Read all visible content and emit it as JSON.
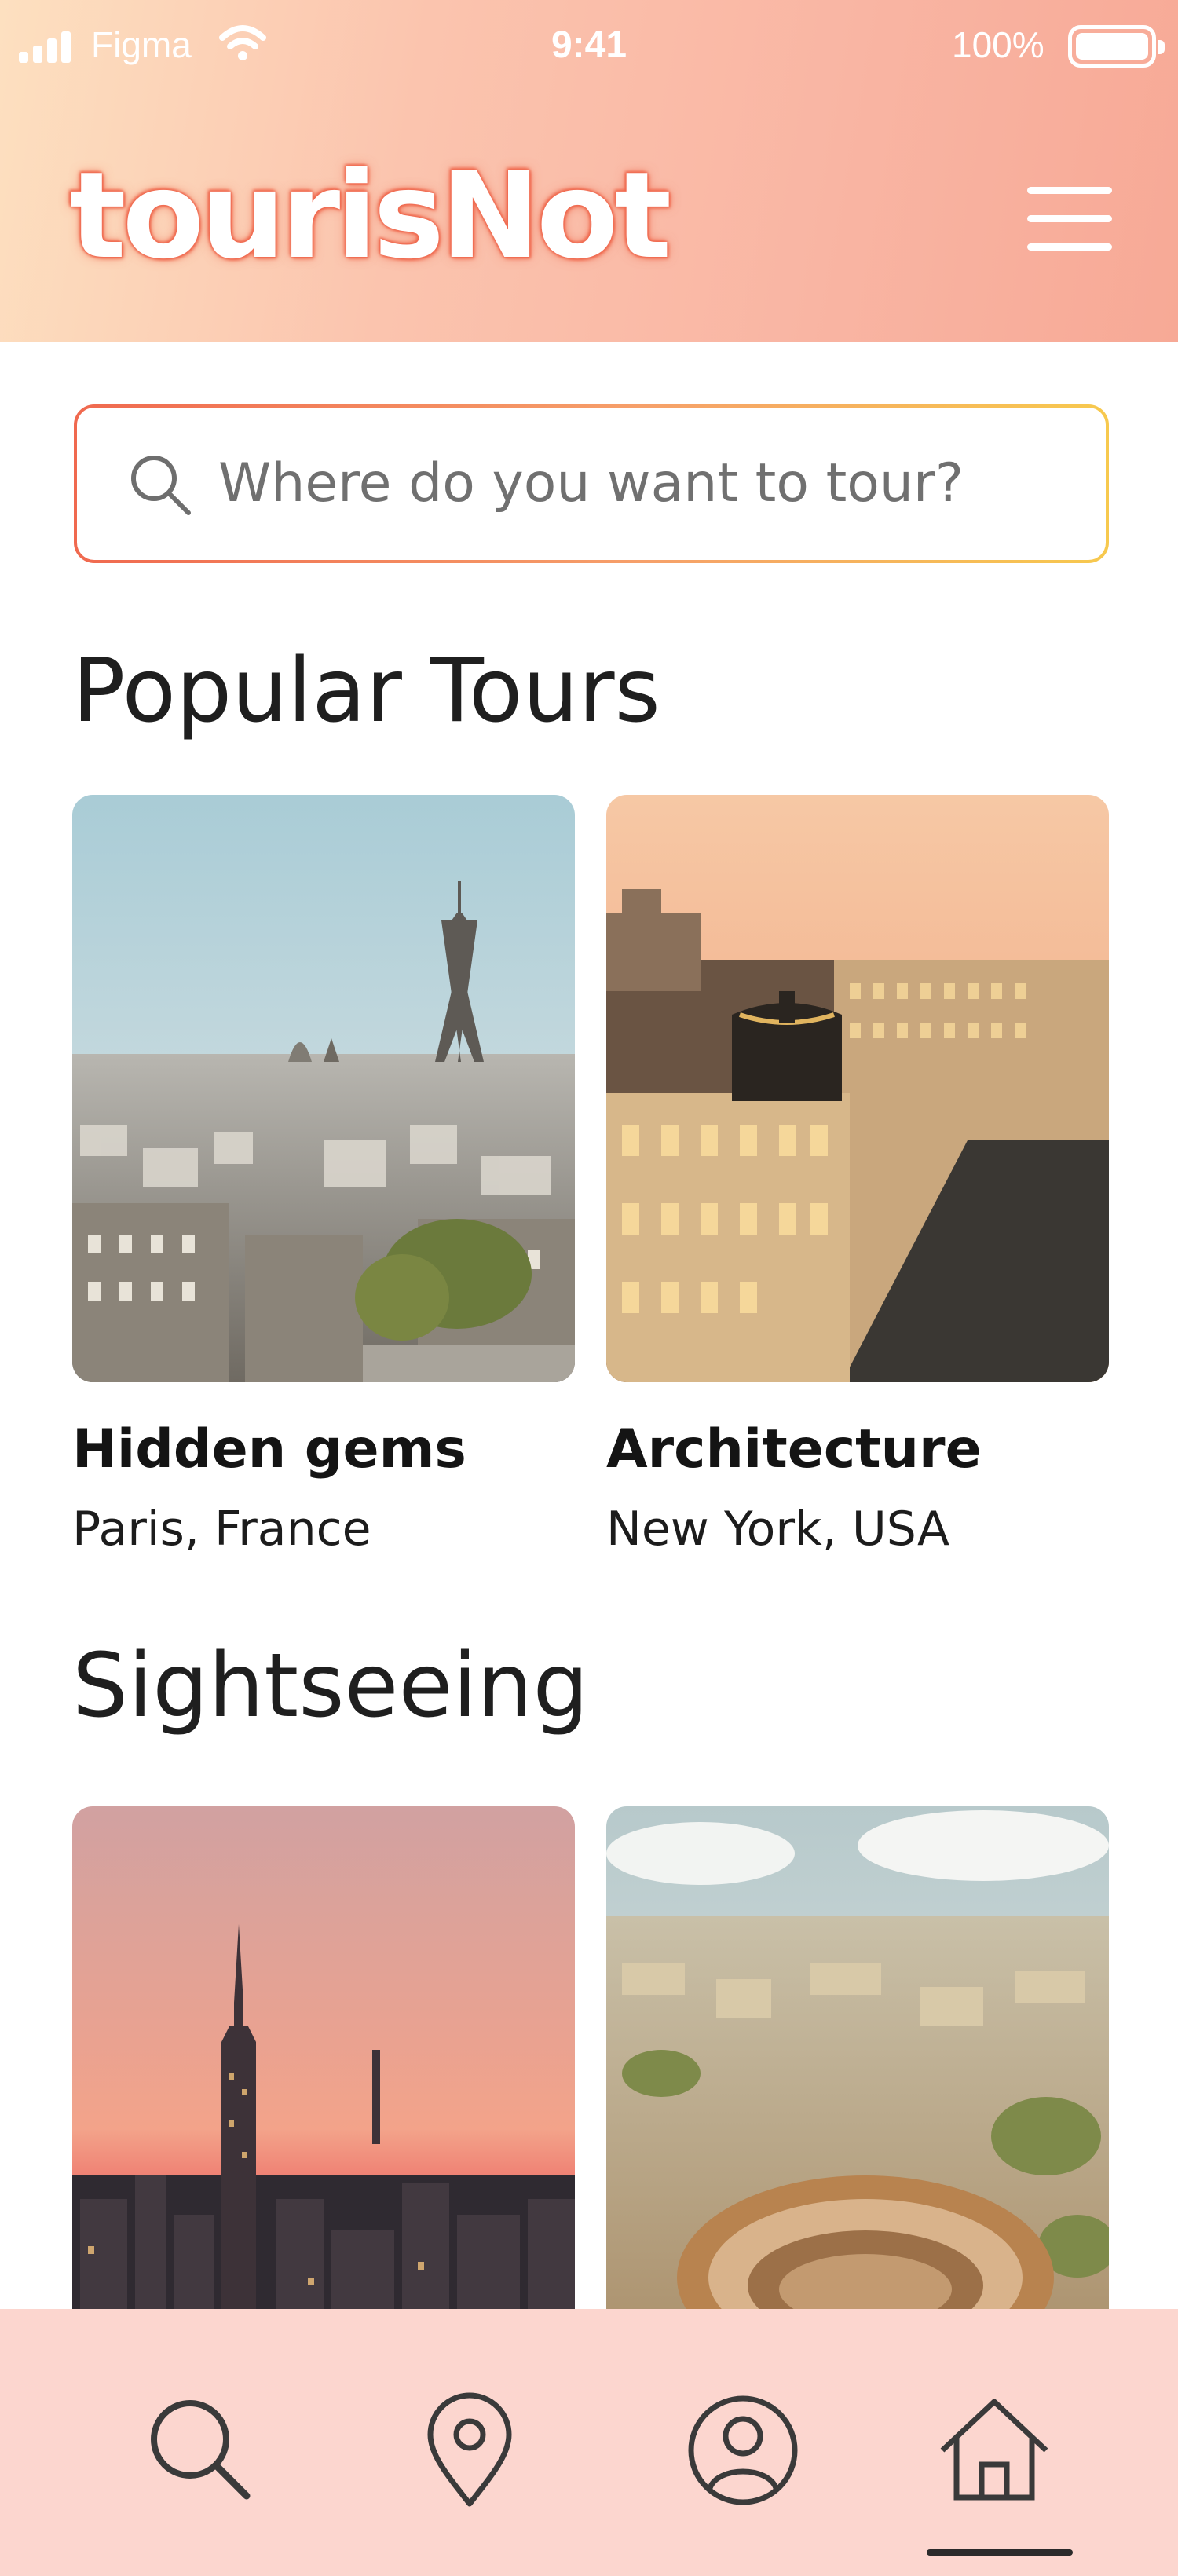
{
  "status_bar": {
    "carrier": "Figma",
    "time": "9:41",
    "battery": "100%"
  },
  "header": {
    "logo": "tourisNot",
    "menu_icon": "hamburger-menu-icon"
  },
  "search": {
    "placeholder": "Where do you want to tour?",
    "icon": "search-icon"
  },
  "sections": [
    {
      "title": "Popular Tours",
      "cards": [
        {
          "title": "Hidden gems",
          "subtitle": "Paris, France",
          "image": "paris-skyline-eiffel-tower-photo"
        },
        {
          "title": "Architecture",
          "subtitle": "New York, USA",
          "image": "domed-building-city-avenue-photo"
        }
      ]
    },
    {
      "title": "Sightseeing",
      "cards": [
        {
          "image": "empire-state-building-sunset-photo"
        },
        {
          "image": "rome-colosseum-aerial-photo"
        }
      ]
    }
  ],
  "bottom_nav": {
    "items": [
      "search-icon",
      "location-pin-icon",
      "profile-icon",
      "home-icon"
    ],
    "active": "home-icon"
  },
  "colors": {
    "header_gradient_start": "#fde0c0",
    "header_gradient_end": "#f7a996",
    "logo_outline": "#f0694f",
    "search_border_start": "#f0694f",
    "search_border_end": "#f7c94e",
    "nav_background": "#fcd6cf",
    "icon_stroke": "#3a3a3a"
  }
}
